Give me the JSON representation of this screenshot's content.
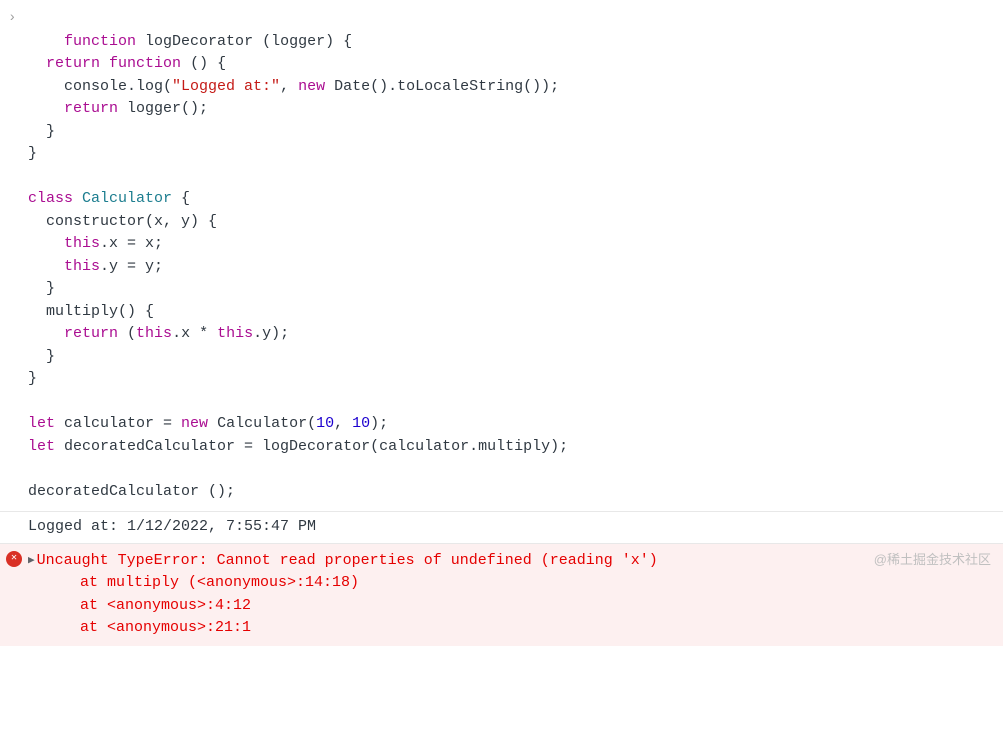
{
  "code": {
    "l1_kw1": "function",
    "l1_fn": "logDecorator",
    "l1_paren": " (logger) {",
    "l2_kw1": "return",
    "l2_kw2": "function",
    "l2_rest": " () {",
    "l3_pre": "    console.log(",
    "l3_str": "\"Logged at:\"",
    "l3_mid": ", ",
    "l3_kw": "new",
    "l3_post": " Date().toLocaleString());",
    "l4_kw": "return",
    "l4_rest": " logger();",
    "l5": "  }",
    "l6": "}",
    "l8_kw": "class",
    "l8_cls": "Calculator",
    "l8_rest": " {",
    "l9": "  constructor(x, y) {",
    "l10_pre": "    ",
    "l10_kw": "this",
    "l10_rest": ".x = x;",
    "l11_pre": "    ",
    "l11_kw": "this",
    "l11_rest": ".y = y;",
    "l12": "  }",
    "l13": "  multiply() {",
    "l14_pre": "    ",
    "l14_kw1": "return",
    "l14_mid1": " (",
    "l14_kw2": "this",
    "l14_mid2": ".x * ",
    "l14_kw3": "this",
    "l14_rest": ".y);",
    "l15": "  }",
    "l16": "}",
    "l18_kw1": "let",
    "l18_mid1": " calculator = ",
    "l18_kw2": "new",
    "l18_mid2": " Calculator(",
    "l18_num1": "10",
    "l18_comma": ", ",
    "l18_num2": "10",
    "l18_rest": ");",
    "l19_kw": "let",
    "l19_rest": " decoratedCalculator = logDecorator(calculator.multiply);",
    "l21": "decoratedCalculator ();"
  },
  "log": "Logged at: 1/12/2022, 7:55:47 PM",
  "error": {
    "message": "Uncaught TypeError: Cannot read properties of undefined (reading 'x')",
    "stack1": "at multiply (<anonymous>:14:18)",
    "stack2": "at <anonymous>:4:12",
    "stack3": "at <anonymous>:21:1"
  },
  "watermark": "@稀土掘金技术社区"
}
